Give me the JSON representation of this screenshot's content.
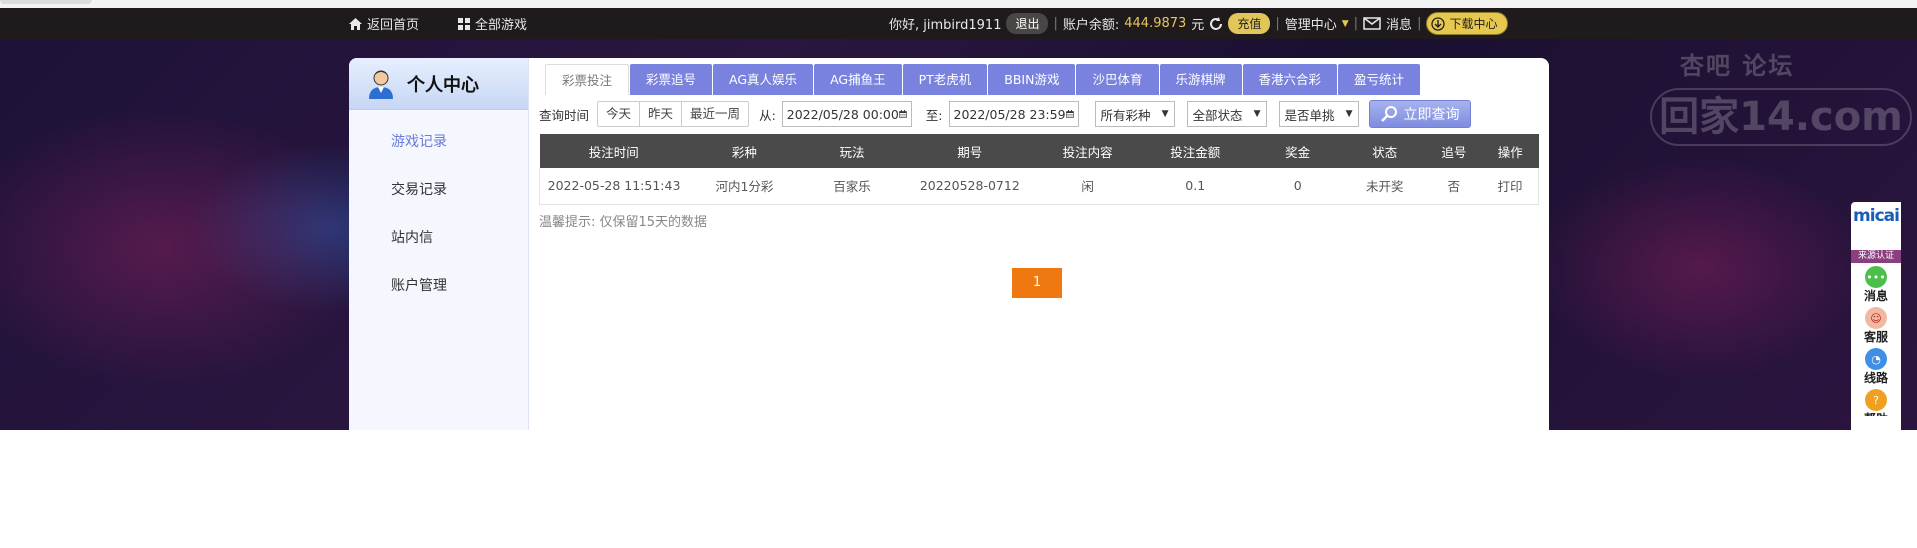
{
  "topbar": {
    "home": "返回首页",
    "all_games": "全部游戏",
    "greeting": "你好, jimbird1911",
    "logout": "退出",
    "balance_label": "账户余额:",
    "balance_value": "444.9873",
    "currency": "元",
    "recharge": "充值",
    "manage": "管理中心",
    "messages": "消息",
    "download": "下载中心"
  },
  "watermark": {
    "line1": "杏吧  论坛",
    "line2": "回家14.com"
  },
  "sidebar": {
    "title": "个人中心",
    "items": [
      {
        "label": "游戏记录"
      },
      {
        "label": "交易记录"
      },
      {
        "label": "站内信"
      },
      {
        "label": "账户管理"
      }
    ]
  },
  "tabs": [
    {
      "label": "彩票投注"
    },
    {
      "label": "彩票追号"
    },
    {
      "label": "AG真人娱乐"
    },
    {
      "label": "AG捕鱼王"
    },
    {
      "label": "PT老虎机"
    },
    {
      "label": "BBIN游戏"
    },
    {
      "label": "沙巴体育"
    },
    {
      "label": "乐游棋牌"
    },
    {
      "label": "香港六合彩"
    },
    {
      "label": "盈亏统计"
    }
  ],
  "filters": {
    "query_time": "查询时间",
    "today": "今天",
    "yesterday": "昨天",
    "last_week": "最近一周",
    "from_label": "从:",
    "from_value": "2022/05/28 00:00",
    "to_label": "至:",
    "to_value": "2022/05/28 23:59",
    "lottery_select": "所有彩种",
    "status_select": "全部状态",
    "single_select": "是否单挑",
    "query_button": "立即查询"
  },
  "table": {
    "headers": [
      "投注时间",
      "彩种",
      "玩法",
      "期号",
      "投注内容",
      "投注金额",
      "奖金",
      "状态",
      "追号",
      "操作"
    ],
    "rows": [
      [
        "2022-05-28 11:51:43",
        "河内1分彩",
        "百家乐",
        "20220528-0712",
        "闲",
        "0.1",
        "0",
        "未开奖",
        "否",
        "打印"
      ]
    ]
  },
  "tip": "温馨提示: 仅保留15天的数据",
  "pager": {
    "current": "1"
  },
  "rightbar": {
    "logo": "micai",
    "source": "来源认证",
    "items": [
      {
        "label": "消息"
      },
      {
        "label": "客服"
      },
      {
        "label": "线路"
      },
      {
        "label": "帮助"
      }
    ]
  },
  "colors": {
    "topbar_bg": "#1f1a1c",
    "tab_bg": "#7a82e0",
    "pager_bg": "#f07810",
    "balance": "#e5c65d"
  }
}
